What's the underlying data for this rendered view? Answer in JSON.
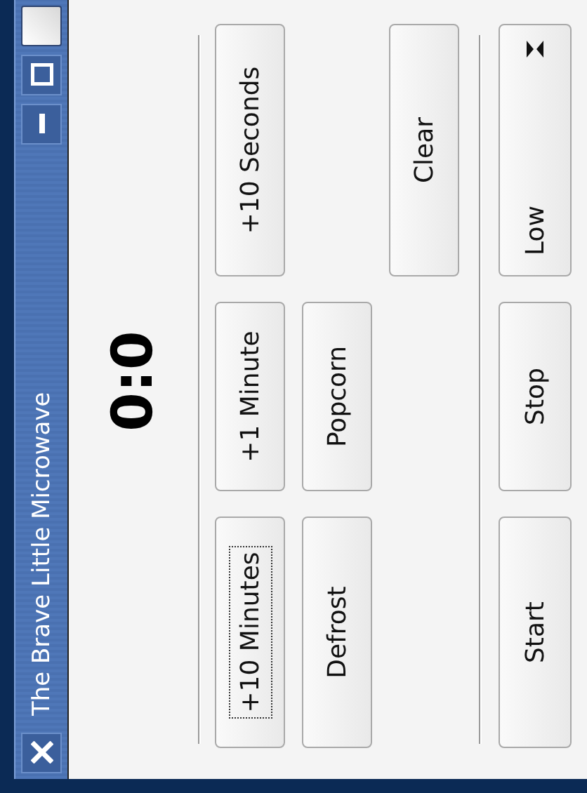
{
  "window": {
    "title": "The Brave Little Microwave",
    "title_buttons": [
      {
        "kind": "close"
      },
      {
        "kind": "minimize"
      },
      {
        "kind": "maximize"
      },
      {
        "kind": "shade"
      }
    ]
  },
  "display": "0:0",
  "keypad": [
    [
      {
        "kind": "button",
        "label": "+10 Minutes",
        "focused": true
      },
      {
        "kind": "button",
        "label": "+1 Minute",
        "focused": false
      },
      {
        "kind": "button",
        "label": "+10 Seconds",
        "focused": false
      }
    ],
    [
      {
        "kind": "button",
        "label": "Defrost",
        "focused": false
      },
      {
        "kind": "button",
        "label": "Popcorn",
        "focused": false
      },
      {
        "kind": "empty"
      }
    ],
    [
      {
        "kind": "empty"
      },
      {
        "kind": "empty"
      },
      {
        "kind": "button",
        "label": "Clear",
        "focused": false
      }
    ]
  ],
  "controls": [
    {
      "kind": "button",
      "label": "Start",
      "focused": false
    },
    {
      "kind": "button",
      "label": "Stop",
      "focused": false
    },
    {
      "kind": "dropdown",
      "value": "Low"
    }
  ]
}
